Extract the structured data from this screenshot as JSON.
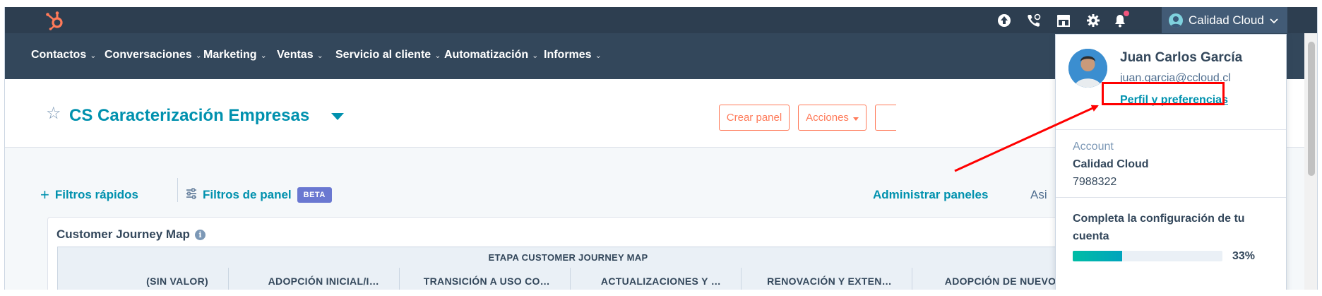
{
  "topbar": {
    "icons": [
      "hubspot-logo-icon",
      "upgrade-icon",
      "calling-icon",
      "marketplace-icon",
      "settings-icon",
      "notifications-icon"
    ],
    "account_label": "Calidad Cloud"
  },
  "nav": {
    "items": [
      {
        "label": "Contactos"
      },
      {
        "label": "Conversaciones"
      },
      {
        "label": "Marketing"
      },
      {
        "label": "Ventas"
      },
      {
        "label": "Servicio al cliente"
      },
      {
        "label": "Automatización"
      },
      {
        "label": "Informes"
      }
    ]
  },
  "header": {
    "title": "CS Caracterización Empresas",
    "create_panel": "Crear panel",
    "actions": "Acciones"
  },
  "filters": {
    "quick": "Filtros rápidos",
    "panel": "Filtros de panel",
    "beta": "BETA",
    "manage": "Administrar paneles",
    "assign_partial": "Asi"
  },
  "report": {
    "title": "Customer Journey Map",
    "group_header": "ETAPA CUSTOMER JOURNEY MAP",
    "columns": [
      "(SIN VALOR)",
      "ADOPCIÓN INICIAL/I…",
      "TRANSICIÓN A USO CO…",
      "ACTUALIZACIONES Y …",
      "RENOVACIÓN Y EXTEN…",
      "ADOPCIÓN DE NUEVOS"
    ]
  },
  "dropdown": {
    "user_name": "Juan Carlos García",
    "email": "juan.garcia@ccloud.cl",
    "profile_link": "Perfil y preferencias",
    "account_label": "Account",
    "account_name": "Calidad Cloud",
    "account_id": "7988322",
    "setup_text": "Completa la configuración de tu cuenta",
    "progress_pct": "33%",
    "progress_value": 0.33
  },
  "colors": {
    "topbar": "#2d3e50",
    "navbar": "#33475b",
    "link": "#0091ae",
    "accent_orange": "#ff7a59",
    "beta": "#6a78d1",
    "annotation": "#ff0000"
  }
}
